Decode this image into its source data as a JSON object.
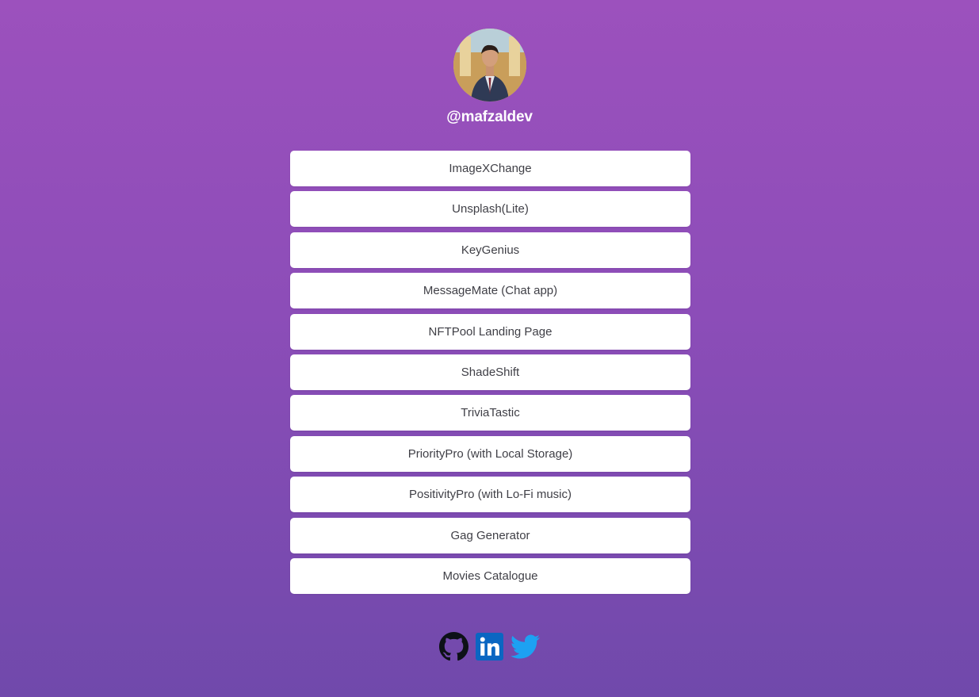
{
  "profile": {
    "handle": "@mafzaldev"
  },
  "links": [
    {
      "label": "ImageXChange"
    },
    {
      "label": "Unsplash(Lite)"
    },
    {
      "label": "KeyGenius"
    },
    {
      "label": "MessageMate (Chat app)"
    },
    {
      "label": "NFTPool Landing Page"
    },
    {
      "label": "ShadeShift"
    },
    {
      "label": "TriviaTastic"
    },
    {
      "label": "PriorityPro (with Local Storage)"
    },
    {
      "label": "PositivityPro (with Lo-Fi music)"
    },
    {
      "label": "Gag Generator"
    },
    {
      "label": "Movies Catalogue"
    }
  ],
  "socials": [
    {
      "icon": "github-icon"
    },
    {
      "icon": "linkedin-icon",
      "color": "#0a66c2"
    },
    {
      "icon": "twitter-icon",
      "color": "#1da1f2"
    }
  ],
  "colors": {
    "background_top": "#9c51bd",
    "background_bottom": "#7049ab",
    "button_bg": "#ffffff",
    "button_text": "#3f3f46",
    "handle_text": "#ffffff"
  }
}
